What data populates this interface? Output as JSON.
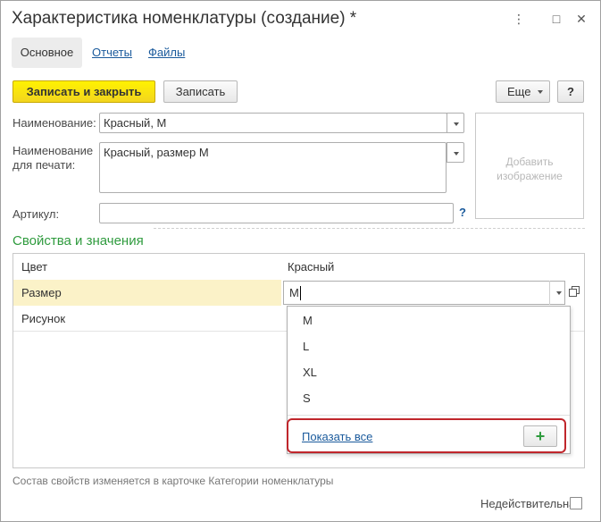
{
  "window": {
    "title": "Характеристика номенклатуры (создание) *",
    "controls": {
      "more": "⋮",
      "maximize": "□",
      "close": "✕"
    }
  },
  "tabs": [
    {
      "label": "Основное",
      "active": true
    },
    {
      "label": "Отчеты",
      "active": false
    },
    {
      "label": "Файлы",
      "active": false
    }
  ],
  "toolbar": {
    "save_close_label": "Записать и закрыть",
    "save_label": "Записать",
    "more_label": "Еще",
    "help_label": "?"
  },
  "form": {
    "name_label": "Наименование:",
    "name_value": "Красный, M",
    "print_name_label_line1": "Наименование",
    "print_name_label_line2": "для печати:",
    "print_name_value": "Красный, размер M",
    "article_label": "Артикул:",
    "article_value": "",
    "article_help": "?"
  },
  "image": {
    "placeholder_line1": "Добавить",
    "placeholder_line2": "изображение"
  },
  "properties": {
    "title": "Свойства и значения",
    "rows": [
      {
        "name": "Цвет",
        "value": "Красный"
      },
      {
        "name": "Размер",
        "value": "M"
      },
      {
        "name": "Рисунок",
        "value": ""
      }
    ]
  },
  "dropdown": {
    "options": [
      "M",
      "L",
      "XL",
      "S"
    ],
    "show_all_label": "Показать все",
    "add_label": "+"
  },
  "footer": {
    "note": "Состав свойств изменяется в карточке Категории номенклатуры",
    "inactive_label": "Недействительна:",
    "inactive_checked": false
  },
  "colors": {
    "accent_green": "#2f9b3e",
    "link_blue": "#1a5a9c",
    "primary_yellow": "#f3d51f",
    "highlight_red": "#c0262c",
    "selected_row": "#fbf2c8"
  }
}
